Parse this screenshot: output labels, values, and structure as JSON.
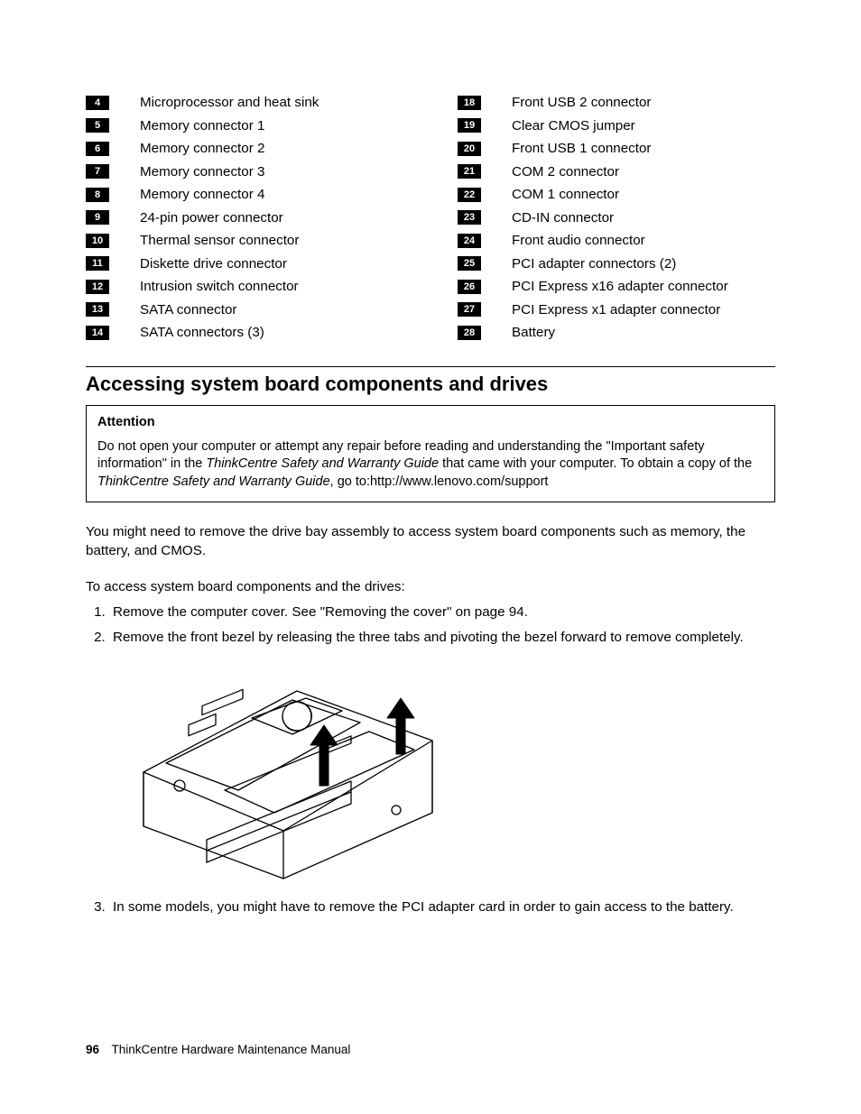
{
  "parts_left": [
    {
      "num": "4",
      "label": "Microprocessor and heat sink"
    },
    {
      "num": "5",
      "label": "Memory connector 1"
    },
    {
      "num": "6",
      "label": "Memory connector 2"
    },
    {
      "num": "7",
      "label": "Memory connector 3"
    },
    {
      "num": "8",
      "label": "Memory connector 4"
    },
    {
      "num": "9",
      "label": "24-pin power connector"
    },
    {
      "num": "10",
      "label": "Thermal sensor connector"
    },
    {
      "num": "11",
      "label": "Diskette drive connector"
    },
    {
      "num": "12",
      "label": "Intrusion switch connector"
    },
    {
      "num": "13",
      "label": "SATA connector"
    },
    {
      "num": "14",
      "label": "SATA connectors (3)"
    }
  ],
  "parts_right": [
    {
      "num": "18",
      "label": "Front USB 2 connector"
    },
    {
      "num": "19",
      "label": "Clear CMOS jumper"
    },
    {
      "num": "20",
      "label": "Front USB 1 connector"
    },
    {
      "num": "21",
      "label": "COM 2 connector"
    },
    {
      "num": "22",
      "label": "COM 1 connector"
    },
    {
      "num": "23",
      "label": "CD-IN connector"
    },
    {
      "num": "24",
      "label": "Front audio connector"
    },
    {
      "num": "25",
      "label": "PCI adapter connectors (2)"
    },
    {
      "num": "26",
      "label": "PCI Express x16 adapter connector"
    },
    {
      "num": "27",
      "label": "PCI Express x1 adapter connector"
    },
    {
      "num": "28",
      "label": "Battery"
    }
  ],
  "section_heading": "Accessing system board components and drives",
  "attention": {
    "title": "Attention",
    "pre": "Do not open your computer or attempt any repair before reading and understanding the \"Important safety information\" in the ",
    "guide1": "ThinkCentre Safety and Warranty Guide",
    "mid": " that came with your computer. To obtain a copy of the ",
    "guide2": "ThinkCentre Safety and Warranty Guide",
    "post": ", go to:http://www.lenovo.com/support"
  },
  "para1": "You might need to remove the drive bay assembly to access system board components such as memory, the battery, and CMOS.",
  "para2": "To access system board components and the drives:",
  "step1": "Remove the computer cover. See \"Removing the cover\" on page 94.",
  "step2": "Remove the front bezel by releasing the three tabs and pivoting the bezel forward to remove completely.",
  "step3": "In some models, you might have to remove the PCI adapter card in order to gain access to the battery.",
  "footer": {
    "page_num": "96",
    "doc_title": "ThinkCentre Hardware Maintenance Manual"
  }
}
